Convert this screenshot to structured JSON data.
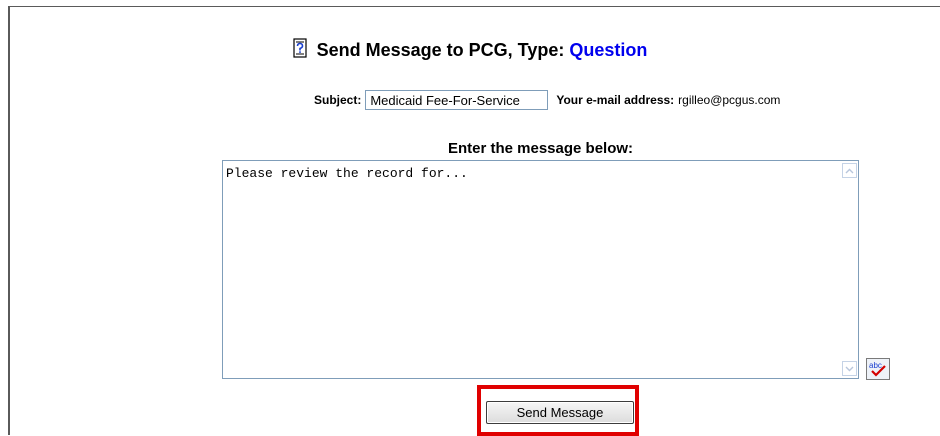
{
  "header": {
    "title_prefix": "Send Message to PCG, Type:",
    "type_value": "Question",
    "icon": "document-question-icon"
  },
  "form": {
    "subject_label": "Subject:",
    "subject_value": "Medicaid Fee-For-Service",
    "email_label": "Your e-mail address:",
    "email_value": "rgilleo@pcgus.com"
  },
  "message": {
    "heading": "Enter the message below:",
    "body": "Please review the record for..."
  },
  "actions": {
    "send_label": "Send Message",
    "spellcheck_icon": "spellcheck-icon"
  },
  "colors": {
    "type_value": "#0000ee",
    "highlight": "#e00000",
    "input_border": "#7f9db9"
  }
}
